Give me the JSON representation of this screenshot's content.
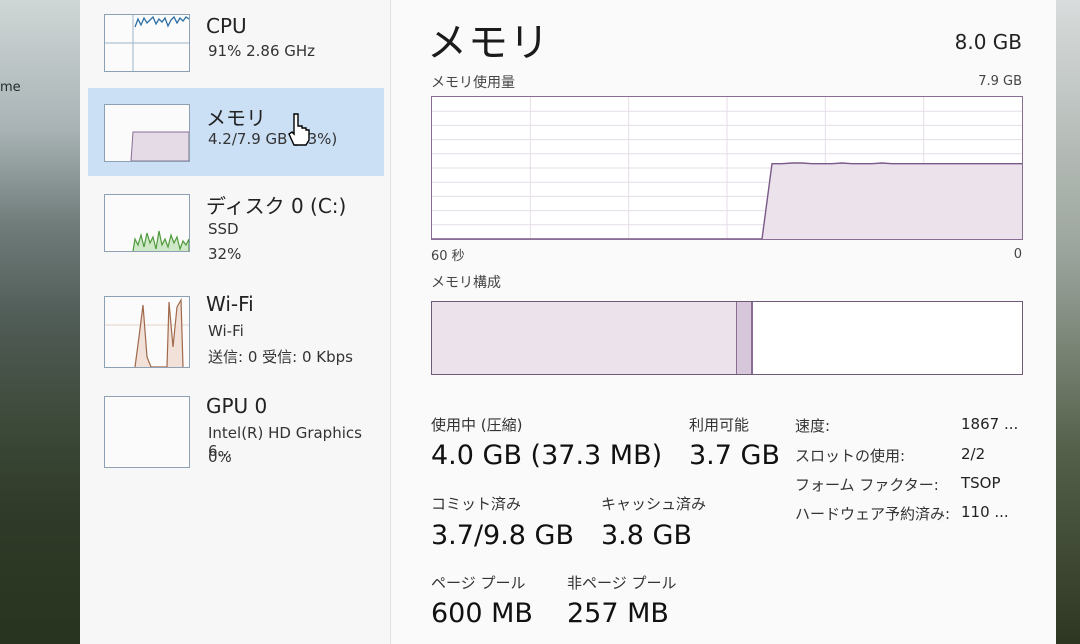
{
  "desktop": {
    "label": "me"
  },
  "sidebar": {
    "items": [
      {
        "title": "CPU",
        "sub1": "91%  2.86 GHz",
        "sub2": ""
      },
      {
        "title": "メモリ",
        "sub1": "4.2/7.9 GB (53%)",
        "sub2": ""
      },
      {
        "title": "ディスク 0 (C:)",
        "sub1": "SSD",
        "sub2": "32%"
      },
      {
        "title": "Wi-Fi",
        "sub1": "Wi-Fi",
        "sub2": "送信: 0  受信: 0 Kbps"
      },
      {
        "title": "GPU 0",
        "sub1": "Intel(R) HD Graphics 6...",
        "sub2": "0%"
      }
    ]
  },
  "main": {
    "title": "メモリ",
    "total": "8.0 GB",
    "usage_label": "メモリ使用量",
    "usage_max": "7.9 GB",
    "axis_left": "60 秒",
    "axis_right": "0",
    "composition_label": "メモリ構成",
    "usage_history_fraction": [
      0,
      0,
      0,
      0,
      0,
      0,
      0,
      0,
      0,
      0,
      0,
      0,
      0,
      0,
      0,
      0,
      0,
      0,
      0,
      0,
      0,
      0,
      0,
      0,
      0,
      0,
      0,
      0,
      0,
      0,
      0,
      0,
      0,
      0,
      0.53,
      0.53,
      0.535,
      0.535,
      0.53,
      0.53,
      0.53,
      0.535,
      0.53,
      0.53,
      0.53,
      0.535,
      0.53,
      0.53,
      0.53,
      0.53,
      0.53,
      0.53,
      0.53,
      0.53,
      0.53,
      0.53,
      0.53,
      0.53,
      0.53,
      0.53
    ],
    "stats": {
      "in_use_label": "使用中 (圧縮)",
      "in_use_value": "4.0 GB (37.3 MB)",
      "available_label": "利用可能",
      "available_value": "3.7 GB",
      "committed_label": "コミット済み",
      "committed_value": "3.7/9.8 GB",
      "cached_label": "キャッシュ済み",
      "cached_value": "3.8 GB",
      "paged_label": "ページ プール",
      "paged_value": "600 MB",
      "nonpaged_label": "非ページ プール",
      "nonpaged_value": "257 MB"
    },
    "specs": [
      {
        "k": "速度:",
        "v": "1867 ..."
      },
      {
        "k": "スロットの使用:",
        "v": "2/2"
      },
      {
        "k": "フォーム ファクター:",
        "v": "TSOP"
      },
      {
        "k": "ハードウェア予約済み:",
        "v": "110 ..."
      }
    ]
  }
}
